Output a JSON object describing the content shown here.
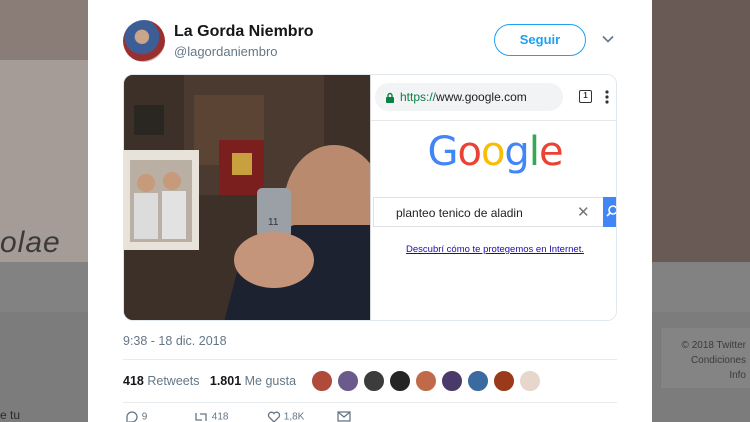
{
  "tweet": {
    "display_name": "La Gorda Niembro",
    "handle": "@lagordaniembro",
    "follow_label": "Seguir",
    "timestamp": "9:38 - 18 dic. 2018",
    "retweets_count": "418",
    "retweets_label": "Retweets",
    "likes_count": "1.801",
    "likes_label": "Me gusta",
    "reply_count": "9",
    "retweet_action_count": "418",
    "like_action_count": "1,8K"
  },
  "screenshot": {
    "url_protocol": "https://",
    "url_host": "www.google.com",
    "tab_count": "1",
    "search_query": "planteo tenico de aladin",
    "privacy_link": "Descubrí cómo te protegemos en Internet."
  },
  "logo_text": [
    "G",
    "o",
    "o",
    "g",
    "l",
    "e"
  ],
  "background": {
    "left_word": "olae",
    "left_text": "e tu",
    "footer_line1": "© 2018 Twitter",
    "footer_line2": "Condiciones",
    "footer_line3": "Info"
  },
  "colors": {
    "accent": "#1da1f2",
    "muted": "#657786",
    "google_blue": "#4285f4",
    "google_red": "#ea4335",
    "google_yellow": "#fbbc05",
    "google_green": "#34a853"
  }
}
